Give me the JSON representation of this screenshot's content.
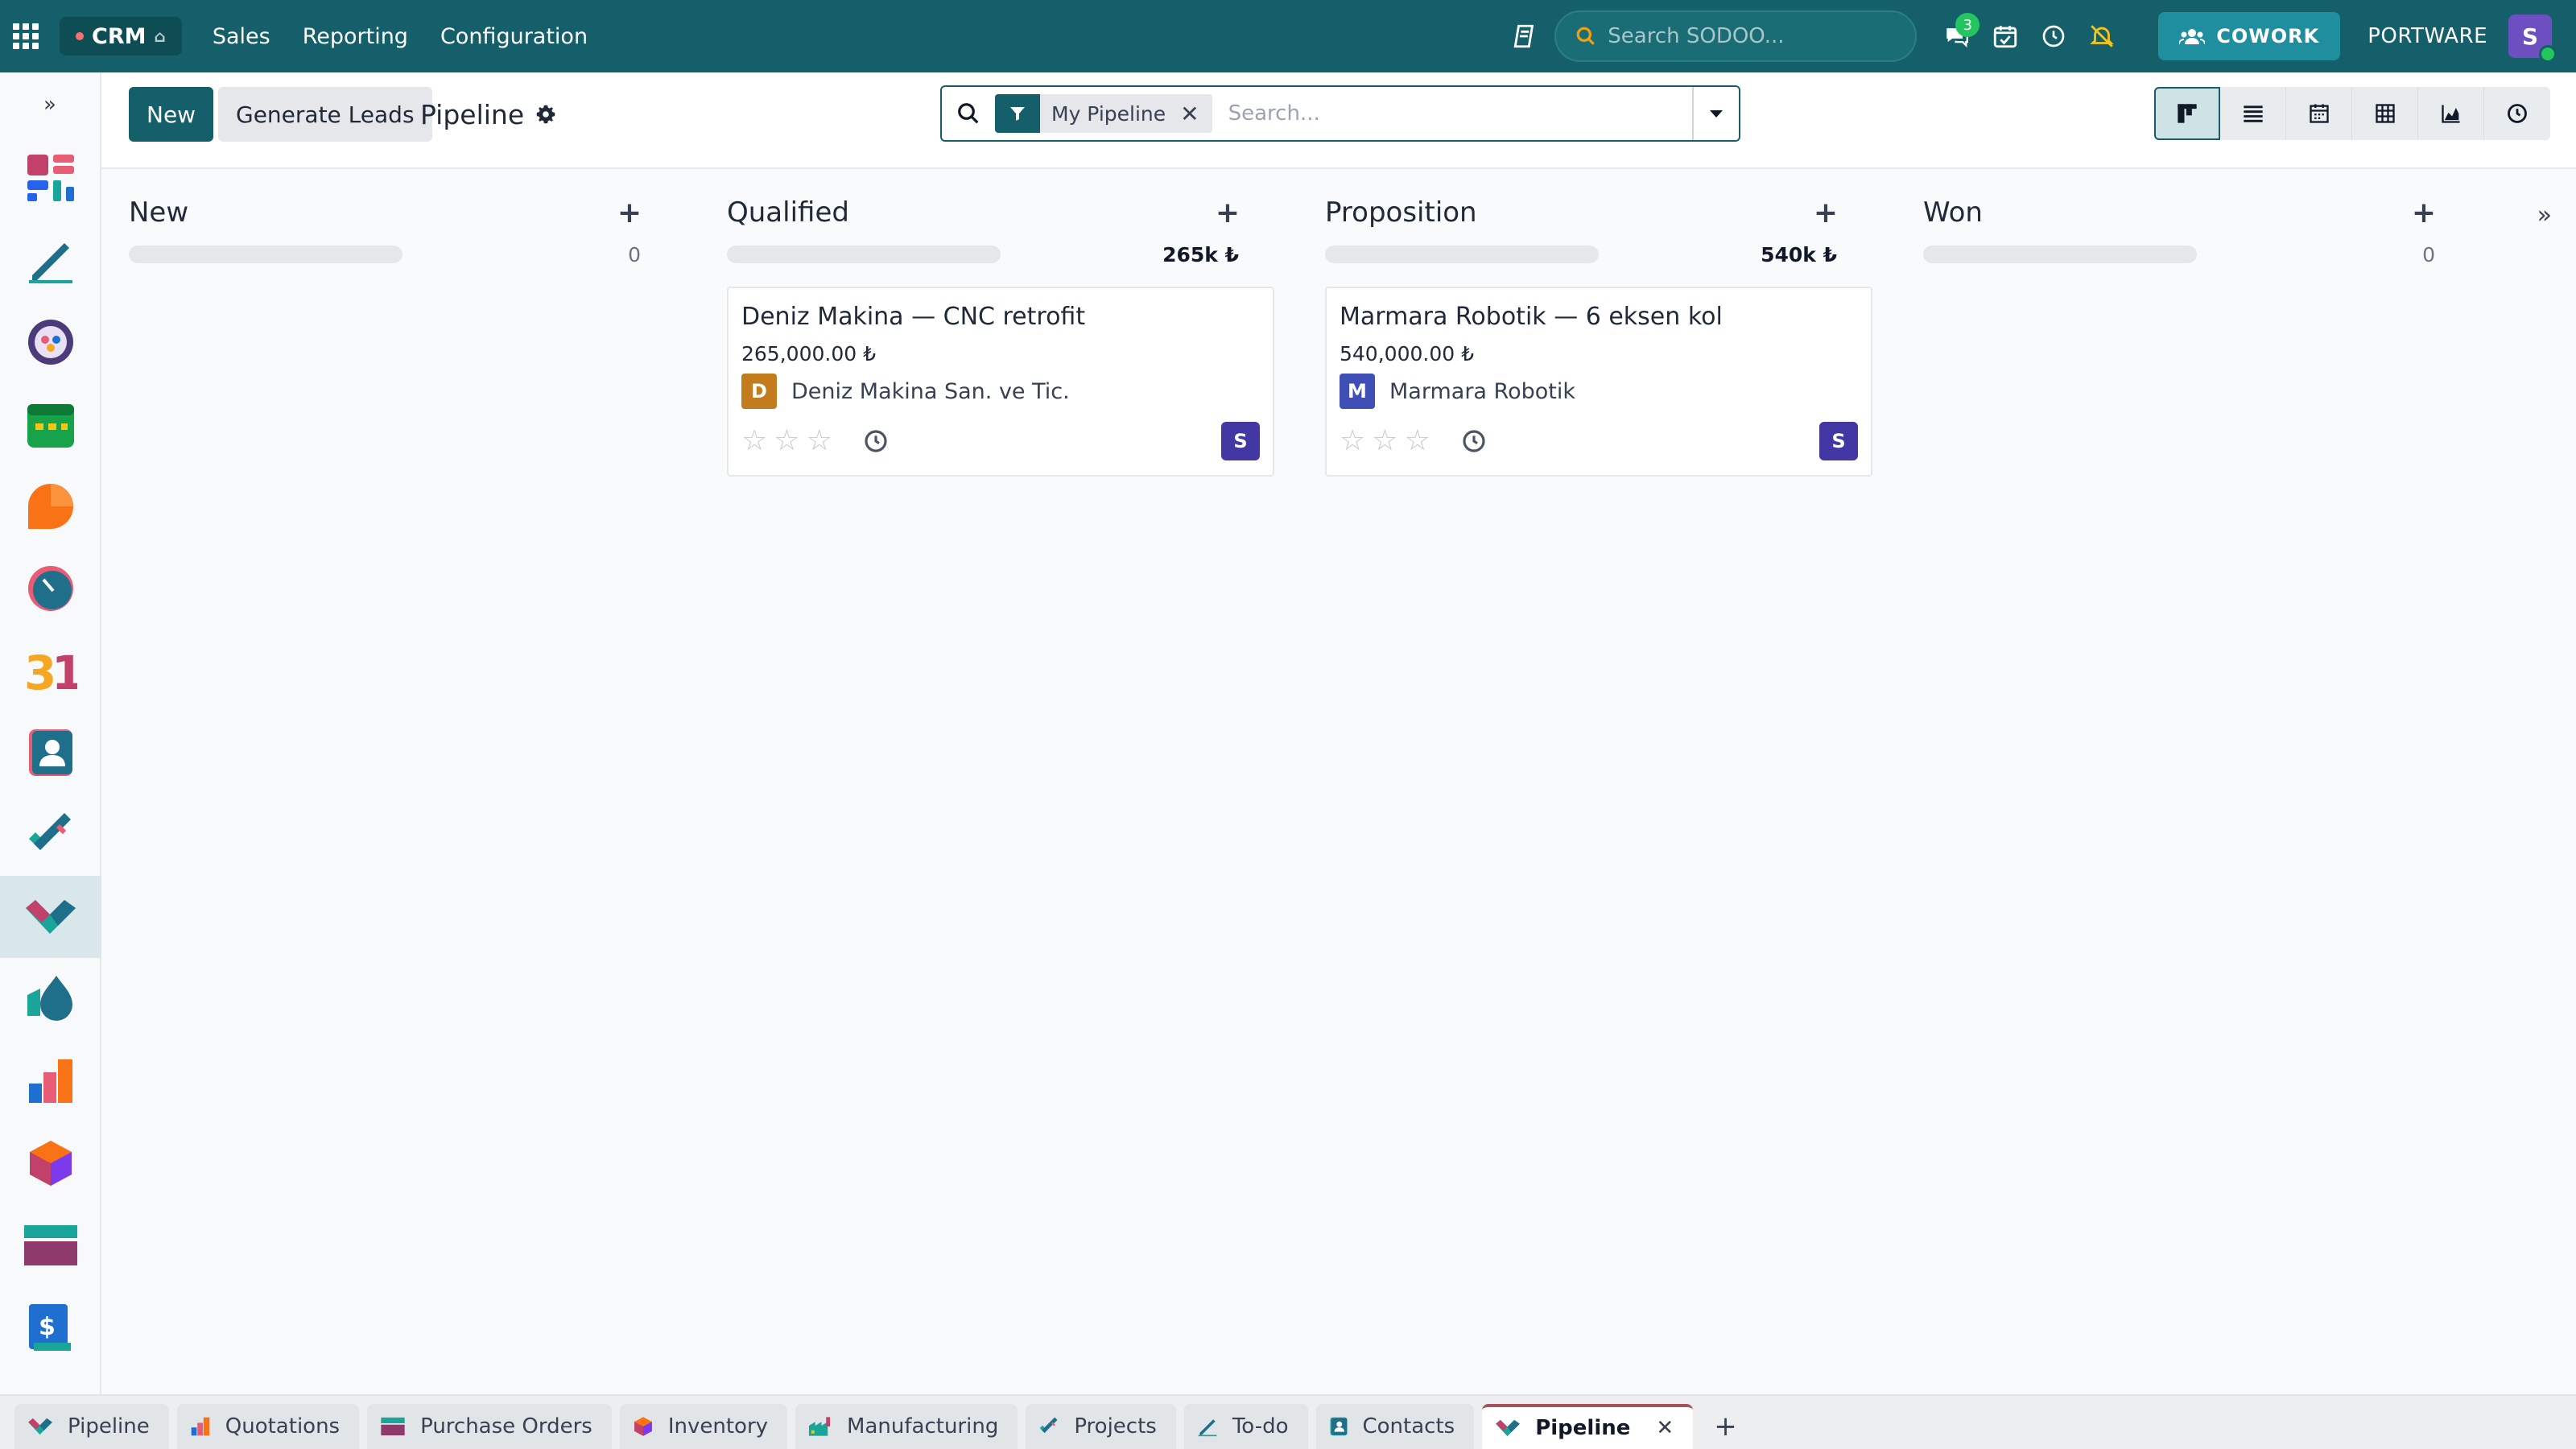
{
  "topbar": {
    "app_name": "CRM",
    "menu": [
      "Sales",
      "Reporting",
      "Configuration"
    ],
    "search_placeholder": "Search SODOO...",
    "messages_badge": "3",
    "cowork_label": "COWORK",
    "company": "PORTWARE",
    "user_initial": "S"
  },
  "control": {
    "new_label": "New",
    "generate_label": "Generate Leads",
    "breadcrumb": "Pipeline",
    "filter_facet": "My Pipeline",
    "search_placeholder": "Search..."
  },
  "columns": [
    {
      "title": "New",
      "sum": "0",
      "cards": []
    },
    {
      "title": "Qualified",
      "sum": "265k ₺",
      "cards": [
        {
          "title": "Deniz Makina — CNC retrofit",
          "amount": "265,000.00 ₺",
          "partner_initial": "D",
          "partner": "Deniz Makina San. ve Tic.",
          "partner_color": "#c27c1e",
          "user_initial": "S"
        }
      ]
    },
    {
      "title": "Proposition",
      "sum": "540k ₺",
      "cards": [
        {
          "title": "Marmara Robotik — 6 eksen kol",
          "amount": "540,000.00 ₺",
          "partner_initial": "M",
          "partner": "Marmara Robotik",
          "partner_color": "#3f4fb5",
          "user_initial": "S"
        }
      ]
    },
    {
      "title": "Won",
      "sum": "0",
      "cards": []
    }
  ],
  "tabs": [
    {
      "label": "Pipeline",
      "icon": "crm-icon"
    },
    {
      "label": "Quotations",
      "icon": "sales-icon"
    },
    {
      "label": "Purchase Orders",
      "icon": "purchase-icon"
    },
    {
      "label": "Inventory",
      "icon": "inventory-icon"
    },
    {
      "label": "Manufacturing",
      "icon": "manufacturing-icon"
    },
    {
      "label": "Projects",
      "icon": "projects-icon"
    },
    {
      "label": "To-do",
      "icon": "todo-icon"
    },
    {
      "label": "Contacts",
      "icon": "contacts-icon"
    },
    {
      "label": "Pipeline",
      "icon": "crm-icon",
      "active": true
    }
  ],
  "colors": {
    "brand": "#145f69",
    "active_tab_accent": "#a7515c"
  }
}
